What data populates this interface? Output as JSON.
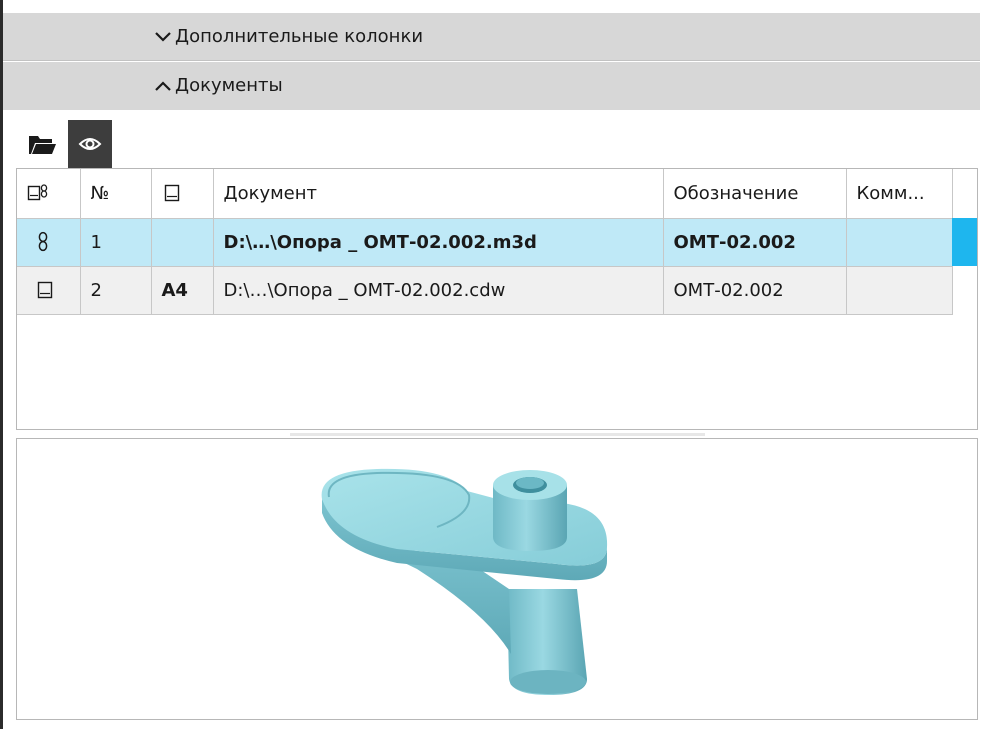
{
  "sections": {
    "additional_columns": "Дополнительные колонки",
    "documents": "Документы"
  },
  "toolbar": {
    "open_icon": "folder-open-icon",
    "preview_icon": "eye-icon"
  },
  "table": {
    "headers": {
      "type_icon": "link-document-icon",
      "number": "№",
      "format_icon": "sheet-icon",
      "document": "Документ",
      "designation": "Обозначение",
      "comment": "Комм..."
    },
    "rows": [
      {
        "type_icon": "chain-link-icon",
        "number": "1",
        "format": "",
        "document": "D:\\…\\Опора _ ОМТ-02.002.m3d",
        "designation": "ОМТ-02.002",
        "comment": "",
        "selected": true
      },
      {
        "type_icon": "sheet-icon",
        "number": "2",
        "format": "A4",
        "document": "D:\\…\\Опора _ ОМТ-02.002.cdw",
        "designation": "ОМТ-02.002",
        "comment": "",
        "selected": false
      }
    ]
  },
  "preview": {
    "model_color": "#8fd3dd",
    "icon": "3d-part-preview"
  },
  "colors": {
    "section_bg": "#d7d7d7",
    "selected_row": "#bfe9f7",
    "selection_accent": "#1eb6ee"
  }
}
